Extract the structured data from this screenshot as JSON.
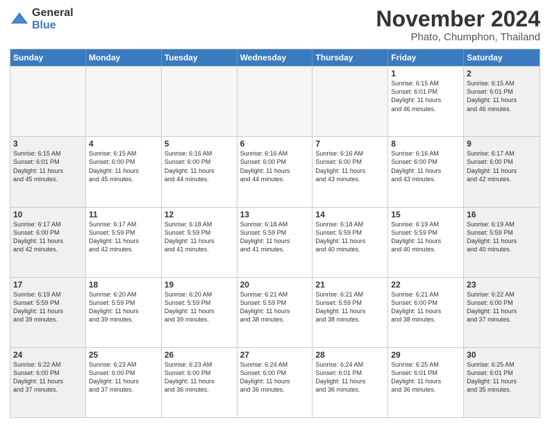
{
  "logo": {
    "general": "General",
    "blue": "Blue"
  },
  "title": "November 2024",
  "location": "Phato, Chumphon, Thailand",
  "days_of_week": [
    "Sunday",
    "Monday",
    "Tuesday",
    "Wednesday",
    "Thursday",
    "Friday",
    "Saturday"
  ],
  "weeks": [
    [
      {
        "day": "",
        "info": ""
      },
      {
        "day": "",
        "info": ""
      },
      {
        "day": "",
        "info": ""
      },
      {
        "day": "",
        "info": ""
      },
      {
        "day": "",
        "info": ""
      },
      {
        "day": "1",
        "info": "Sunrise: 6:15 AM\nSunset: 6:01 PM\nDaylight: 11 hours\nand 46 minutes."
      },
      {
        "day": "2",
        "info": "Sunrise: 6:15 AM\nSunset: 6:01 PM\nDaylight: 11 hours\nand 46 minutes."
      }
    ],
    [
      {
        "day": "3",
        "info": "Sunrise: 6:15 AM\nSunset: 6:01 PM\nDaylight: 11 hours\nand 45 minutes."
      },
      {
        "day": "4",
        "info": "Sunrise: 6:15 AM\nSunset: 6:00 PM\nDaylight: 11 hours\nand 45 minutes."
      },
      {
        "day": "5",
        "info": "Sunrise: 6:16 AM\nSunset: 6:00 PM\nDaylight: 11 hours\nand 44 minutes."
      },
      {
        "day": "6",
        "info": "Sunrise: 6:16 AM\nSunset: 6:00 PM\nDaylight: 11 hours\nand 44 minutes."
      },
      {
        "day": "7",
        "info": "Sunrise: 6:16 AM\nSunset: 6:00 PM\nDaylight: 11 hours\nand 43 minutes."
      },
      {
        "day": "8",
        "info": "Sunrise: 6:16 AM\nSunset: 6:00 PM\nDaylight: 11 hours\nand 43 minutes."
      },
      {
        "day": "9",
        "info": "Sunrise: 6:17 AM\nSunset: 6:00 PM\nDaylight: 11 hours\nand 42 minutes."
      }
    ],
    [
      {
        "day": "10",
        "info": "Sunrise: 6:17 AM\nSunset: 6:00 PM\nDaylight: 11 hours\nand 42 minutes."
      },
      {
        "day": "11",
        "info": "Sunrise: 6:17 AM\nSunset: 5:59 PM\nDaylight: 11 hours\nand 42 minutes."
      },
      {
        "day": "12",
        "info": "Sunrise: 6:18 AM\nSunset: 5:59 PM\nDaylight: 11 hours\nand 41 minutes."
      },
      {
        "day": "13",
        "info": "Sunrise: 6:18 AM\nSunset: 5:59 PM\nDaylight: 11 hours\nand 41 minutes."
      },
      {
        "day": "14",
        "info": "Sunrise: 6:18 AM\nSunset: 5:59 PM\nDaylight: 11 hours\nand 40 minutes."
      },
      {
        "day": "15",
        "info": "Sunrise: 6:19 AM\nSunset: 5:59 PM\nDaylight: 11 hours\nand 40 minutes."
      },
      {
        "day": "16",
        "info": "Sunrise: 6:19 AM\nSunset: 5:59 PM\nDaylight: 11 hours\nand 40 minutes."
      }
    ],
    [
      {
        "day": "17",
        "info": "Sunrise: 6:19 AM\nSunset: 5:59 PM\nDaylight: 11 hours\nand 39 minutes."
      },
      {
        "day": "18",
        "info": "Sunrise: 6:20 AM\nSunset: 5:59 PM\nDaylight: 11 hours\nand 39 minutes."
      },
      {
        "day": "19",
        "info": "Sunrise: 6:20 AM\nSunset: 5:59 PM\nDaylight: 11 hours\nand 39 minutes."
      },
      {
        "day": "20",
        "info": "Sunrise: 6:21 AM\nSunset: 5:59 PM\nDaylight: 11 hours\nand 38 minutes."
      },
      {
        "day": "21",
        "info": "Sunrise: 6:21 AM\nSunset: 5:59 PM\nDaylight: 11 hours\nand 38 minutes."
      },
      {
        "day": "22",
        "info": "Sunrise: 6:21 AM\nSunset: 6:00 PM\nDaylight: 11 hours\nand 38 minutes."
      },
      {
        "day": "23",
        "info": "Sunrise: 6:22 AM\nSunset: 6:00 PM\nDaylight: 11 hours\nand 37 minutes."
      }
    ],
    [
      {
        "day": "24",
        "info": "Sunrise: 6:22 AM\nSunset: 6:00 PM\nDaylight: 11 hours\nand 37 minutes."
      },
      {
        "day": "25",
        "info": "Sunrise: 6:23 AM\nSunset: 6:00 PM\nDaylight: 11 hours\nand 37 minutes."
      },
      {
        "day": "26",
        "info": "Sunrise: 6:23 AM\nSunset: 6:00 PM\nDaylight: 11 hours\nand 36 minutes."
      },
      {
        "day": "27",
        "info": "Sunrise: 6:24 AM\nSunset: 6:00 PM\nDaylight: 11 hours\nand 36 minutes."
      },
      {
        "day": "28",
        "info": "Sunrise: 6:24 AM\nSunset: 6:01 PM\nDaylight: 11 hours\nand 36 minutes."
      },
      {
        "day": "29",
        "info": "Sunrise: 6:25 AM\nSunset: 6:01 PM\nDaylight: 11 hours\nand 36 minutes."
      },
      {
        "day": "30",
        "info": "Sunrise: 6:25 AM\nSunset: 6:01 PM\nDaylight: 11 hours\nand 35 minutes."
      }
    ]
  ]
}
